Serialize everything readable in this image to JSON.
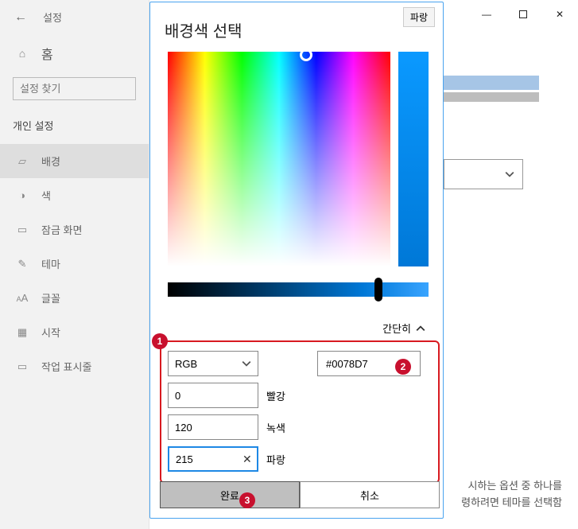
{
  "sidebar": {
    "app_title": "설정",
    "home": "홈",
    "search_placeholder": "설정 찾기",
    "category": "개인 설정",
    "items": [
      {
        "label": "배경"
      },
      {
        "label": "색"
      },
      {
        "label": "잠금 화면"
      },
      {
        "label": "테마"
      },
      {
        "label": "글꼴"
      },
      {
        "label": "시작"
      },
      {
        "label": "작업 표시줄"
      }
    ]
  },
  "content": {
    "swatch_colors": [
      "#e6a6cf",
      "#d89ae0",
      "#d6a1e6",
      "#dcb8f0",
      "#a6c5e6",
      "#99b9df",
      "#9cbfe6",
      "#c4caed",
      "#bdbdbd",
      "#bdbdbd",
      "#d6ccb8",
      "#d6ccb8"
    ],
    "foot_line1": "시하는 옵션 중 하나를",
    "foot_line2": "령하려면 테마를 선택함"
  },
  "dialog": {
    "title": "배경색 선택",
    "tooltip": "파랑",
    "simple_label": "간단히",
    "model": "RGB",
    "hex": "#0078D7",
    "channels": {
      "r": {
        "value": "0",
        "label": "빨강"
      },
      "g": {
        "value": "120",
        "label": "녹색"
      },
      "b": {
        "value": "215",
        "label": "파랑"
      }
    },
    "ok": "완료",
    "cancel": "취소"
  },
  "badges": {
    "one": "1",
    "two": "2",
    "three": "3"
  }
}
